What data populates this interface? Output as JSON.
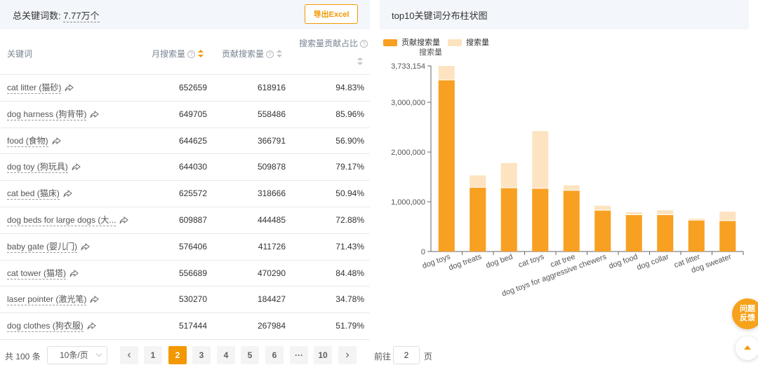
{
  "summary": {
    "label": "总关键词数:",
    "value": "7.77万个",
    "export_label": "导出Excel"
  },
  "table": {
    "headers": {
      "keyword": "关键词",
      "monthly": "月搜索量",
      "contrib": "贡献搜索量",
      "ratio": "搜索量贡献占比"
    },
    "rows": [
      {
        "keyword": "cat litter (猫砂)",
        "monthly": "652659",
        "contrib": "618916",
        "ratio": "94.83%"
      },
      {
        "keyword": "dog harness (狗背带)",
        "monthly": "649705",
        "contrib": "558486",
        "ratio": "85.96%"
      },
      {
        "keyword": "food (食物)",
        "monthly": "644625",
        "contrib": "366791",
        "ratio": "56.90%"
      },
      {
        "keyword": "dog toy (狗玩具)",
        "monthly": "644030",
        "contrib": "509878",
        "ratio": "79.17%"
      },
      {
        "keyword": "cat bed (猫床)",
        "monthly": "625572",
        "contrib": "318666",
        "ratio": "50.94%"
      },
      {
        "keyword": "dog beds for large dogs (大...",
        "monthly": "609887",
        "contrib": "444485",
        "ratio": "72.88%"
      },
      {
        "keyword": "baby gate (婴儿门)",
        "monthly": "576406",
        "contrib": "411726",
        "ratio": "71.43%"
      },
      {
        "keyword": "cat tower (猫塔)",
        "monthly": "556689",
        "contrib": "470290",
        "ratio": "84.48%"
      },
      {
        "keyword": "laser pointer (激光笔)",
        "monthly": "530270",
        "contrib": "184427",
        "ratio": "34.78%"
      },
      {
        "keyword": "dog clothes (狗衣服)",
        "monthly": "517444",
        "contrib": "267984",
        "ratio": "51.79%"
      }
    ]
  },
  "pagination": {
    "total": "共 100 条",
    "page_size": "10条/页",
    "pages": [
      "1",
      "2",
      "3",
      "4",
      "5",
      "6",
      "···",
      "10"
    ],
    "current": "2",
    "prev": "‹",
    "next": "›",
    "jump_label": "前往",
    "jump_value": "2",
    "jump_unit": "页"
  },
  "chart_panel_title": "top10关键词分布柱状图",
  "chart_data": {
    "type": "bar",
    "stacked": true,
    "categories": [
      "dog toys",
      "dog treats",
      "dog bed",
      "cat toys",
      "cat tree",
      "dog toys for aggressive chewers",
      "dog food",
      "dog collar",
      "cat litter",
      "dog sweater"
    ],
    "series": [
      {
        "name": "贡献搜索量",
        "color": "#f7a021",
        "values": [
          3450000,
          1290000,
          1280000,
          1270000,
          1230000,
          830000,
          740000,
          740000,
          630000,
          620000
        ]
      },
      {
        "name": "搜索量",
        "color": "#fde3c0",
        "values": [
          3733154,
          1530000,
          1780000,
          2420000,
          1330000,
          920000,
          790000,
          830000,
          660000,
          800000
        ]
      }
    ],
    "ylabel": "搜索量",
    "ylim": [
      0,
      3733154
    ],
    "y_ticks": [
      0,
      1000000,
      2000000,
      3000000,
      3733154
    ],
    "y_tick_labels": [
      "0",
      "1,000,000",
      "2,000,000",
      "3,000,000",
      "3,733,154"
    ],
    "legend_position": "top-left",
    "grid": false
  },
  "float_buttons": {
    "feedback": "问题\n反馈"
  },
  "colors": {
    "accent": "#f39800",
    "header_bg": "#f3f6fb"
  }
}
